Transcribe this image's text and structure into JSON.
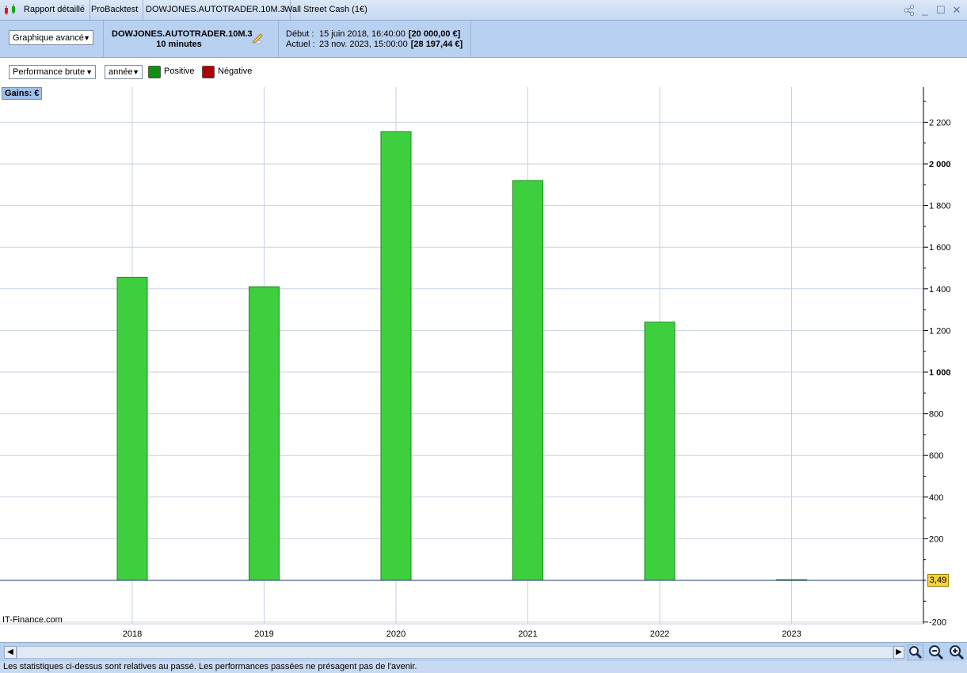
{
  "titlebar": {
    "tabs": [
      "Rapport détaillé",
      "ProBacktest",
      "DOWJONES.AUTOTRADER.10M.3",
      "Wall Street Cash (1€)"
    ]
  },
  "infobar": {
    "mode": "Graphique avancé",
    "system_name": "DOWJONES.AUTOTRADER.10M.3",
    "timeframe": "10 minutes",
    "start_label": "Début :",
    "start_date": "15 juin 2018, 16:40:00",
    "start_capital": "[20 000,00 €]",
    "current_label": "Actuel :",
    "current_date": "23 nov. 2023, 15:00:00",
    "current_capital": "[28 197,44 €]"
  },
  "controls": {
    "metric": "Performance brute",
    "period": "année",
    "positive_label": "Positive",
    "negative_label": "Négative",
    "positive_color": "#109010",
    "negative_color": "#b30000"
  },
  "chart_data": {
    "type": "bar",
    "ylabel": "Gains: €",
    "categories": [
      "2018",
      "2019",
      "2020",
      "2021",
      "2022",
      "2023"
    ],
    "values": [
      1455,
      1410,
      2155,
      1920,
      1240,
      3.49
    ],
    "ylim": [
      -200,
      2350
    ],
    "yticks": [
      -200,
      200,
      400,
      600,
      800,
      1000,
      1200,
      1400,
      1600,
      1800,
      2000,
      2200
    ],
    "ytick_labels": [
      "-200",
      "200",
      "400",
      "600",
      "800",
      "1 000",
      "1 200",
      "1 400",
      "1 600",
      "1 800",
      "2 000",
      "2 200"
    ],
    "bold_ticks": [
      1000,
      2000
    ],
    "last_value_badge": "3,49",
    "bar_color": "#3ecf3e",
    "grid": true,
    "watermark": "IT-Finance.com"
  },
  "statusbar": {
    "text": "Les statistiques ci-dessus sont relatives au passé. Les performances passées ne présagent pas de l'avenir."
  }
}
